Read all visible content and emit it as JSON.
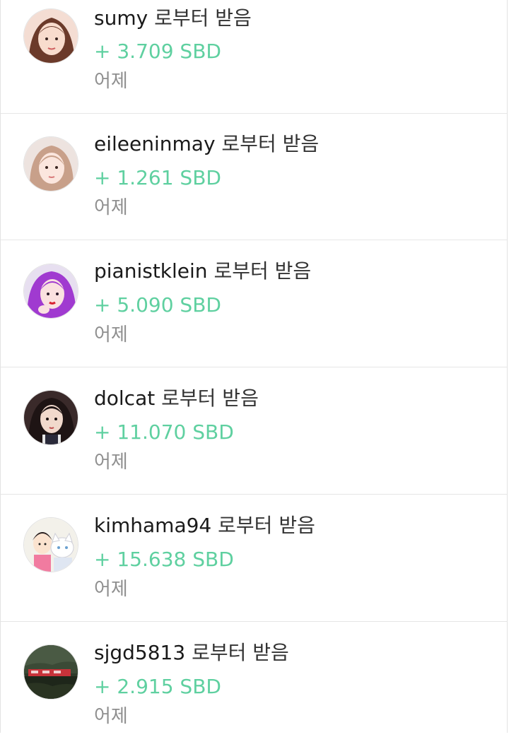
{
  "transfers": [
    {
      "user": "sumy",
      "action": "로부터 받음",
      "amount": "+ 3.709 SBD",
      "time": "어제",
      "avatar": "avatar-woman-icon"
    },
    {
      "user": "eileeninmay",
      "action": "로부터 받음",
      "amount": "+ 1.261 SBD",
      "time": "어제",
      "avatar": "avatar-woman-icon"
    },
    {
      "user": "pianistklein",
      "action": "로부터 받음",
      "amount": "+ 5.090 SBD",
      "time": "어제",
      "avatar": "avatar-purple-hair-icon"
    },
    {
      "user": "dolcat",
      "action": "로부터 받음",
      "amount": "+ 11.070 SBD",
      "time": "어제",
      "avatar": "avatar-woman-icon"
    },
    {
      "user": "kimhama94",
      "action": "로부터 받음",
      "amount": "+ 15.638 SBD",
      "time": "어제",
      "avatar": "avatar-illustration-cat-icon"
    },
    {
      "user": "sjgd5813",
      "action": "로부터 받음",
      "amount": "+ 2.915 SBD",
      "time": "어제",
      "avatar": "avatar-landscape-icon"
    }
  ],
  "colors": {
    "amount": "#5fd0a0",
    "time": "#8f8f8f",
    "name": "#1a1a1a",
    "divider": "#e6e6e6"
  }
}
